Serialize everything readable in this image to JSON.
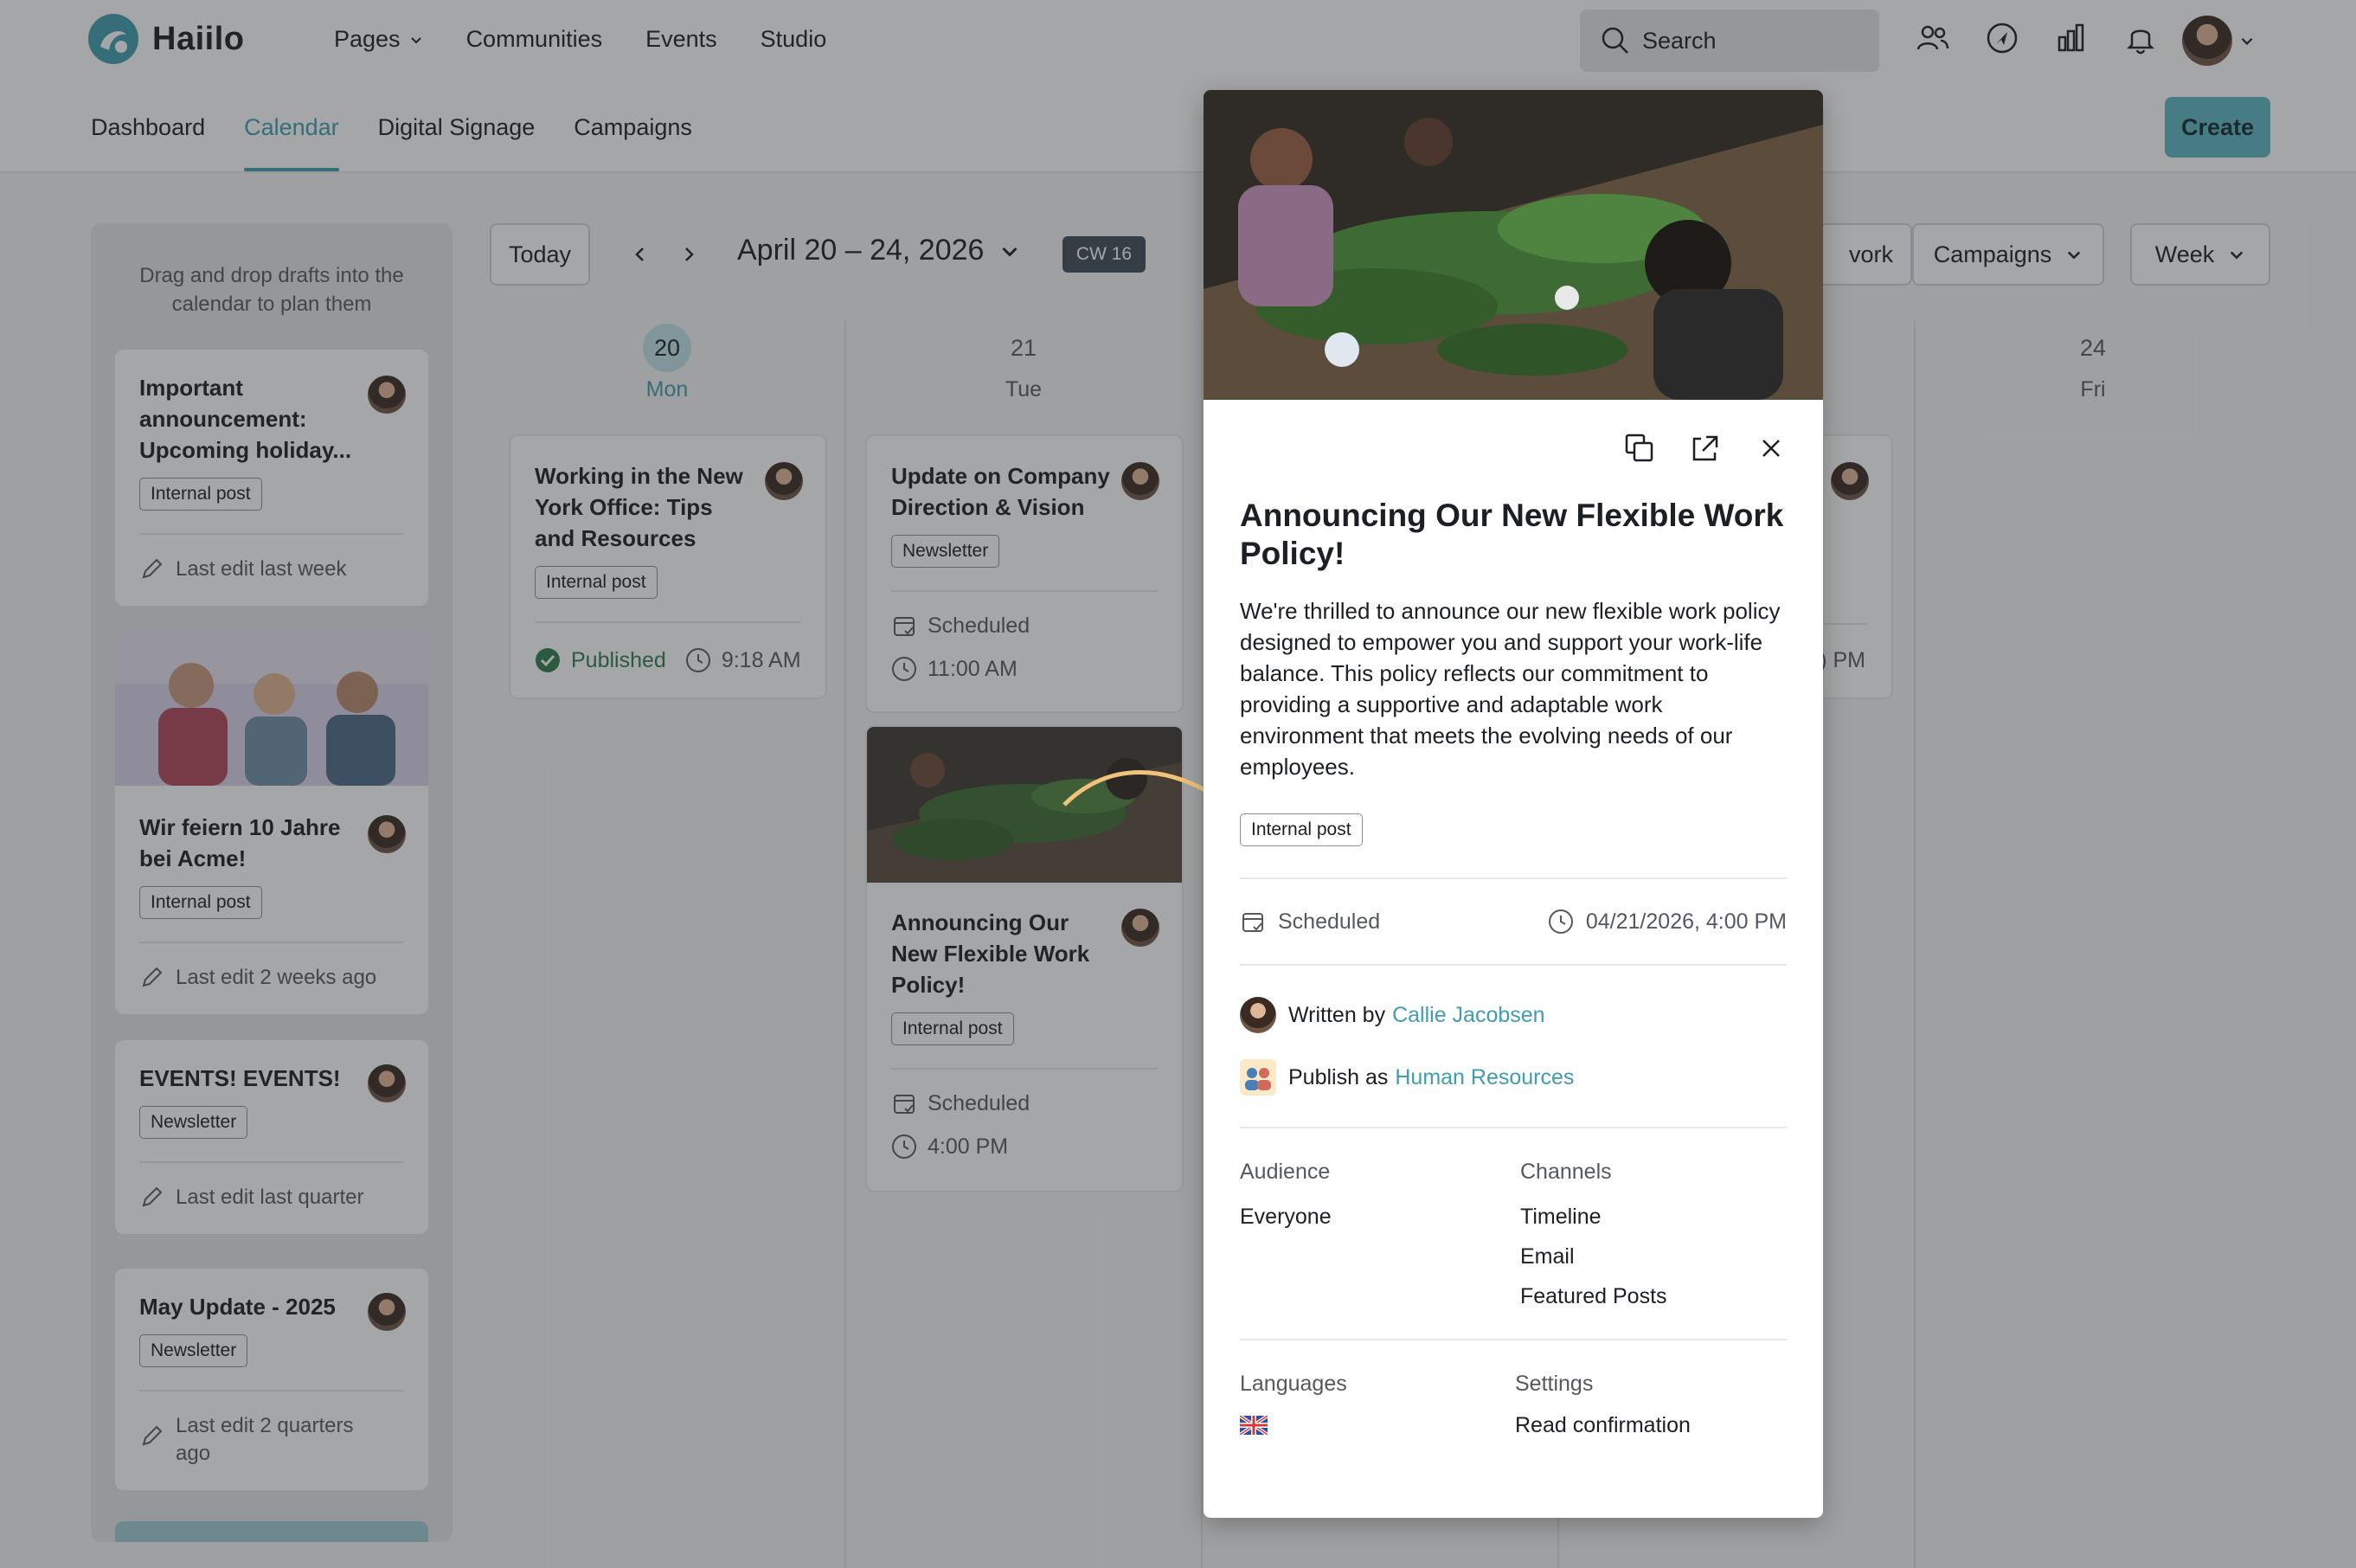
{
  "brand": {
    "name": "Haiilo",
    "accent": "#3f9db0",
    "button": "#5fb7c5"
  },
  "nav": {
    "pages": "Pages",
    "communities": "Communities",
    "events": "Events",
    "studio": "Studio",
    "search_label": "Search"
  },
  "subnav": {
    "dashboard": "Dashboard",
    "calendar": "Calendar",
    "digital_signage": "Digital Signage",
    "campaigns": "Campaigns",
    "create": "Create"
  },
  "drafts": {
    "hint": "Drag and drop drafts into the calendar to plan them",
    "items": [
      {
        "title": "Important announcement: Upcoming holiday...",
        "tag": "Internal post",
        "edit": "Last edit last week"
      },
      {
        "title": "Wir feiern 10 Jahre bei Acme!",
        "tag": "Internal post",
        "edit": "Last edit 2 weeks ago"
      },
      {
        "title": "EVENTS! EVENTS!",
        "tag": "Newsletter",
        "edit": "Last edit last quarter"
      },
      {
        "title": "May Update - 2025",
        "tag": "Newsletter",
        "edit": "Last edit 2 quarters ago"
      }
    ]
  },
  "toolbar": {
    "today": "Today",
    "range": "April 20 – 24, 2026",
    "cw": "CW 16",
    "filter_partial": "vork",
    "campaigns": "Campaigns",
    "view": "Week"
  },
  "days": [
    {
      "num": "20",
      "name": "Mon"
    },
    {
      "num": "21",
      "name": "Tue"
    },
    {
      "num": "24",
      "name": "Fri"
    }
  ],
  "events": {
    "mon": {
      "title": "Working in the New York Office: Tips and Resources",
      "tag": "Internal post",
      "status": "Published",
      "time": "9:18 AM"
    },
    "tue1": {
      "title": "Update on Company Direction & Vision",
      "tag": "Newsletter",
      "status": "Scheduled",
      "time": "11:00 AM"
    },
    "tue2": {
      "title": "Announcing Our New Flexible Work Policy!",
      "tag": "Internal post",
      "status": "Scheduled",
      "time": "4:00 PM"
    },
    "thu_partial_time": ") PM"
  },
  "popover": {
    "title": "Announcing Our New Flexible Work Policy!",
    "body": "We're thrilled to announce our new flexible work policy designed to empower you and support your work-life balance. This policy reflects our commitment to providing a supportive and adaptable work environment that meets the evolving needs of our employees.",
    "tag": "Internal post",
    "status": "Scheduled",
    "datetime": "04/21/2026, 4:00 PM",
    "written_by_label": "Written by",
    "author": "Callie Jacobsen",
    "publish_as_label": "Publish as",
    "publisher": "Human Resources",
    "audience_label": "Audience",
    "audience": "Everyone",
    "channels_label": "Channels",
    "channels": [
      "Timeline",
      "Email",
      "Featured Posts"
    ],
    "languages_label": "Languages",
    "settings_label": "Settings",
    "settings": "Read confirmation"
  }
}
